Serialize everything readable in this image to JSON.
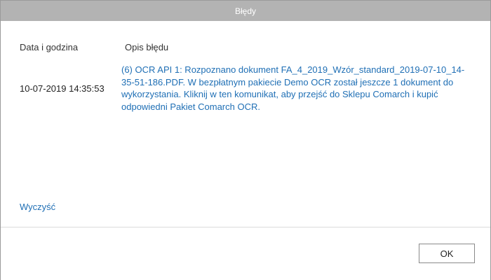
{
  "window": {
    "title": "Błędy"
  },
  "table": {
    "columns": [
      "Data i godzina",
      "Opis błędu"
    ],
    "rows": [
      {
        "datetime": "10-07-2019 14:35:53",
        "description": "(6) OCR API 1: Rozpoznano dokument FA_4_2019_Wzór_standard_2019-07-10_14-35-51-186.PDF. W bezpłatnym pakiecie Demo OCR został jeszcze 1 dokument do wykorzystania. Kliknij w ten komunikat, aby przejść do Sklepu Comarch i kupić odpowiedni Pakiet Comarch OCR."
      }
    ]
  },
  "actions": {
    "clear_label": "Wyczyść",
    "ok_label": "OK"
  },
  "colors": {
    "titlebar": "#b3b3b3",
    "link": "#1f6fb5"
  }
}
